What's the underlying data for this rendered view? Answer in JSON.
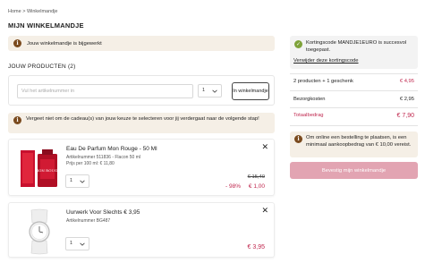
{
  "breadcrumb": {
    "home": "Home",
    "sep": ">",
    "current": "Winkelmandje"
  },
  "page_title": "MIJN WINKELMANDJE",
  "cart_updated": "Jouw winkelmandje is bijgewerkt",
  "products_section": {
    "title": "JOUW PRODUCTEN",
    "count": "(2)"
  },
  "add_product": {
    "placeholder": "Vul het artikelnummer in",
    "qty": "1",
    "button_label": "In winkelmandje"
  },
  "gift_note": "Vergeet niet om de cadeau(s) van jouw keuze te selecteren voor jij verdergaat naar de volgende stap!",
  "items": [
    {
      "name": "Eau De Parfum Mon Rouge - 50 Ml",
      "article": "Artikelnummer 511836 - Flacon 50 ml",
      "unit_price": "Prijs per 100 ml: € 11,80",
      "qty": "1",
      "old_price": "€ 15,40",
      "discount": "- 98%",
      "price": "€ 1,00",
      "image_label": "MON ROUGE"
    },
    {
      "name": "Uurwerk Voor Slechts € 3,95",
      "article": "Artikelnummer BG487",
      "qty": "1",
      "price": "€ 3,95"
    }
  ],
  "promo": {
    "text": "Kortingscode MANDJE1EURO is succesvol toegepast.",
    "remove": "Verwijder deze kortingscode"
  },
  "summary": {
    "products_label": "2 producten + 1 geschenk",
    "products_value": "€ 4,95",
    "shipping_label": "Bezorgkosten",
    "shipping_value": "€ 2,95",
    "total_label": "Totaalbedrag",
    "total_value": "€ 7,90"
  },
  "min_order_note": "Om online een bestelling te plaatsen, is een minimaal aankoopbedrag van € 10,00 vereist.",
  "confirm_button": "Bevestig mijn winkelmandje",
  "colors": {
    "accent": "#c0284f",
    "info_bg": "#f5efe6",
    "confirm_disabled": "#e2a4b2",
    "success": "#7ea23a"
  }
}
